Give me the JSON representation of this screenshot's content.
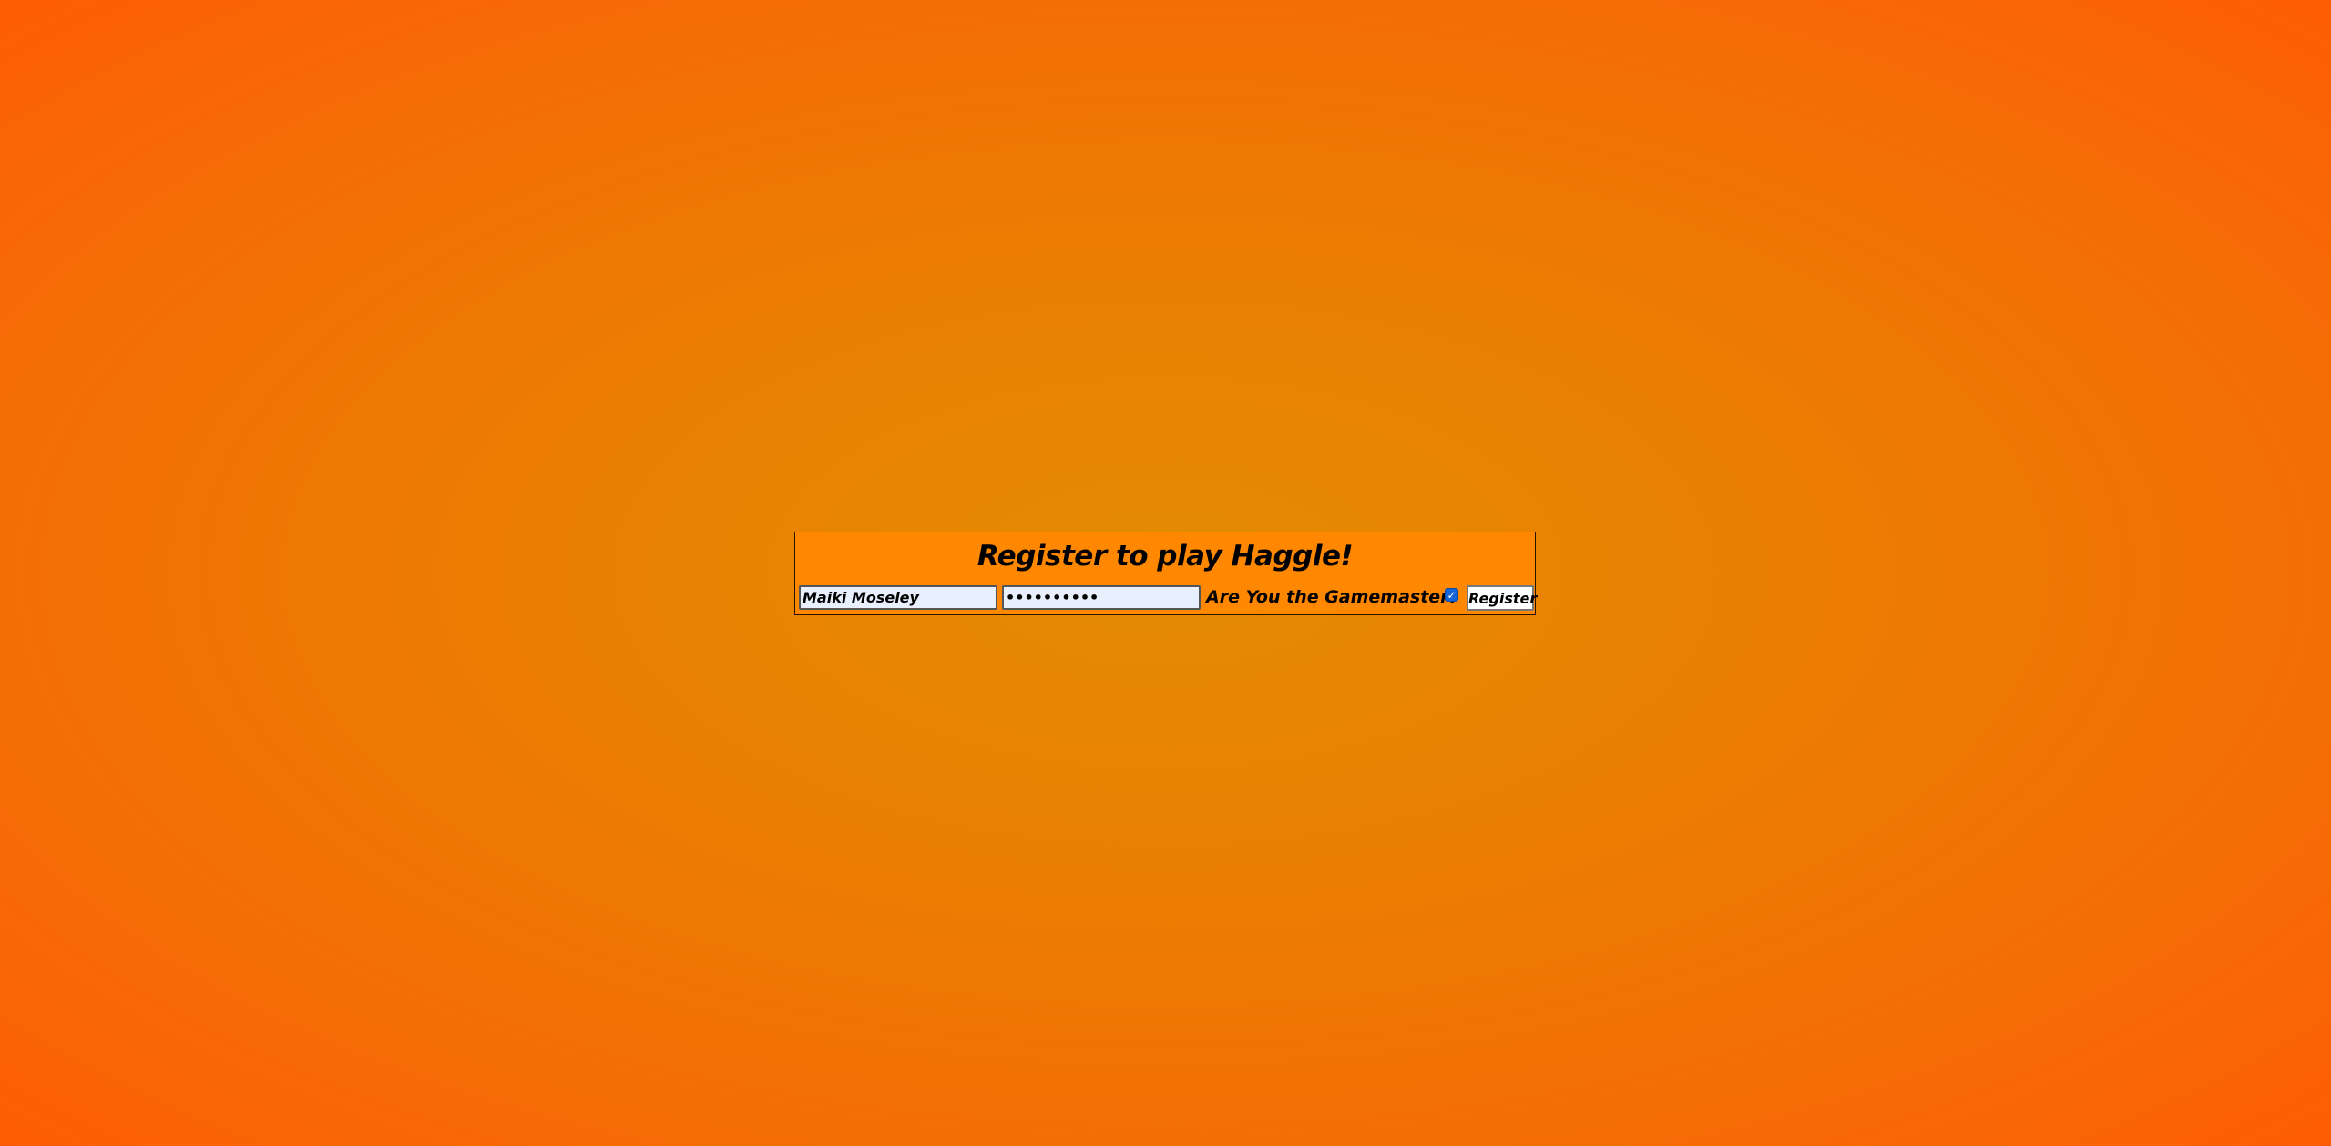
{
  "colors": {
    "panel_background": "#ff8800",
    "page_background_center": "#e38b03",
    "page_background_edge": "#fe5d05",
    "input_background": "#e8f0fe",
    "checkbox_accent": "#1565d8"
  },
  "register": {
    "title": "Register to play Haggle!",
    "username_value": "Maiki Moseley",
    "password_value": "••••••••••",
    "gamemaster_label": "Are You the Gamemaster?",
    "gamemaster_checked": true,
    "checkbox_icon": "checkmark-icon",
    "button_label": "Register"
  }
}
